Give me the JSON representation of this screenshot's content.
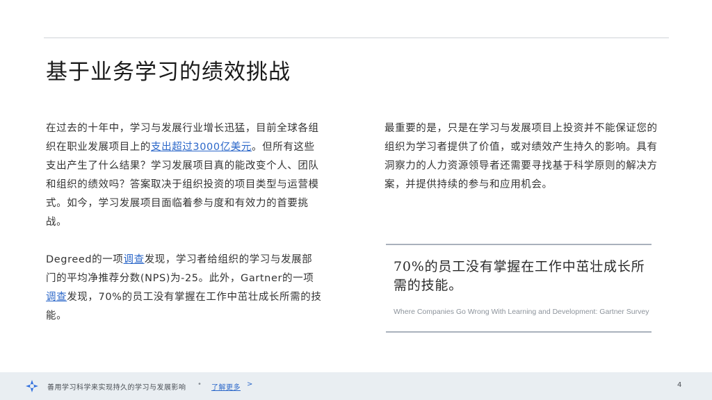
{
  "page": {
    "title": "基于业务学习的绩效挑战"
  },
  "left_column": {
    "p1_part1": "在过去的十年中，学习与发展行业增长迅猛，目前全球各组织在职业发展项目上的",
    "p1_link": "支出超过3000亿美元",
    "p1_part2": "。但所有这些支出产生了什么结果？学习发展项目真的能改变个人、团队和组织的绩效吗？答案取决于组织投资的项目类型与运营模式。如今，学习发展项目面临着参与度和有效力的首要挑战。",
    "p2_part1": "Degreed的一项",
    "p2_link1": "调查",
    "p2_part2": "发现，学习者给组织的学习与发展部门的平均净推荐分数(NPS)为-25。此外，Gartner的一项",
    "p2_link2": "调查",
    "p2_part3": "发现，70%的员工没有掌握在工作中茁壮成长所需的技能。"
  },
  "right_column": {
    "paragraph": "最重要的是，只是在学习与发展项目上投资并不能保证您的组织为学习者提供了价值，或对绩效产生持久的影响。具有洞察力的人力资源领导者还需要寻找基于科学原则的解决方案，并提供持续的参与和应用机会。"
  },
  "quote": {
    "text": "70%的员工没有掌握在工作中茁壮成长所需的技能。",
    "source": "Where Companies Go Wrong With Learning and Development: Gartner Survey"
  },
  "footer": {
    "text": "善用学习科学来实现持久的学习与发展影响",
    "separator": "•",
    "link_label": "了解更多",
    "chevron": ">",
    "page_number": "4"
  },
  "colors": {
    "accent_link": "#2b67c9",
    "logo_blue": "#2f6fde",
    "footer_bg": "#e9eef2"
  },
  "icons": {
    "footer_logo": "degreed-logo-icon"
  }
}
